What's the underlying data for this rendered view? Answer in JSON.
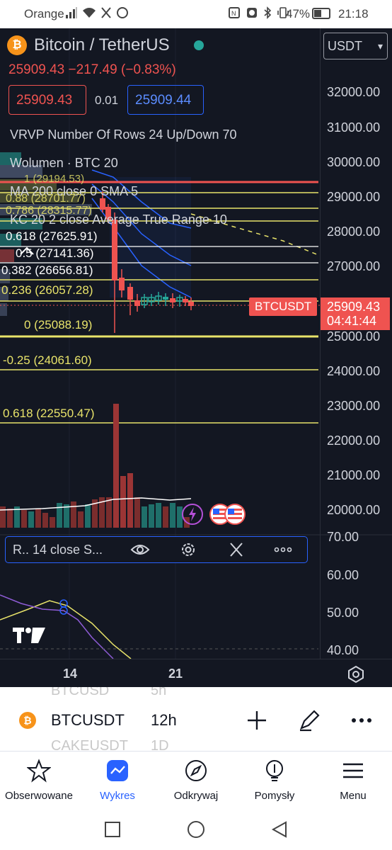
{
  "status_bar": {
    "carrier": "Orange",
    "battery": "47%",
    "time": "21:18"
  },
  "header": {
    "symbol_title": "Bitcoin / TetherUS",
    "currency": "USDT",
    "last_price": "25909.43",
    "change": "−217.49 (−0.83%)",
    "sell_price": "25909.43",
    "spread": "0.01",
    "buy_price": "25909.44"
  },
  "indicators": {
    "vrvp": "VRVP Number Of Rows 24 Up/Down 70",
    "volume": "Wolumen · BTC 20",
    "ma": "MA 200 close 0 SMA 5",
    "kc": "KC 20 2 close Average True Range 10"
  },
  "fib_levels": [
    {
      "label": "1 (29194.53)"
    },
    {
      "label": "0.88 (28701.77)"
    },
    {
      "label": "0.786 (28315.77)"
    },
    {
      "label": "0.618 (27625.91)"
    },
    {
      "label": "0.5 (27141.36)"
    },
    {
      "label": "0.382 (26656.81)"
    },
    {
      "label": "0.236 (26057.28)"
    },
    {
      "label": "0 (25088.19)"
    },
    {
      "label": "-0.25 (24061.60)"
    },
    {
      "label": "0.618 (22550.47)"
    }
  ],
  "price_axis": [
    "32000.00",
    "31000.00",
    "30000.00",
    "29000.00",
    "28000.00",
    "27000.00",
    "25000.00",
    "24000.00",
    "23000.00",
    "22000.00",
    "21000.00",
    "20000.00"
  ],
  "price_tag": {
    "symbol": "BTCUSDT",
    "price": "25909.43",
    "countdown": "04:41:44"
  },
  "oscillator": {
    "name": "R.. 14 close S...",
    "levels": [
      "70.00",
      "60.00",
      "50.00",
      "40.00"
    ]
  },
  "time_axis": [
    "14",
    "21"
  ],
  "symbol_bar": {
    "ghost_above": "BTCUSD",
    "ghost_above_tf": "5h",
    "symbol": "BTCUSDT",
    "timeframe": "12h",
    "ghost_below": "CAKEUSDT",
    "ghost_below_tf": "1D"
  },
  "bottom_nav": [
    {
      "label": "Obserwowane",
      "icon": "star-icon"
    },
    {
      "label": "Wykres",
      "icon": "chart-icon"
    },
    {
      "label": "Odkrywaj",
      "icon": "compass-icon"
    },
    {
      "label": "Pomysły",
      "icon": "lightbulb-icon"
    },
    {
      "label": "Menu",
      "icon": "hamburger-icon"
    }
  ],
  "colors": {
    "background": "#131722",
    "down": "#ef5350",
    "up": "#26a69a",
    "fib": "#e8e36a",
    "accent": "#2962ff"
  }
}
